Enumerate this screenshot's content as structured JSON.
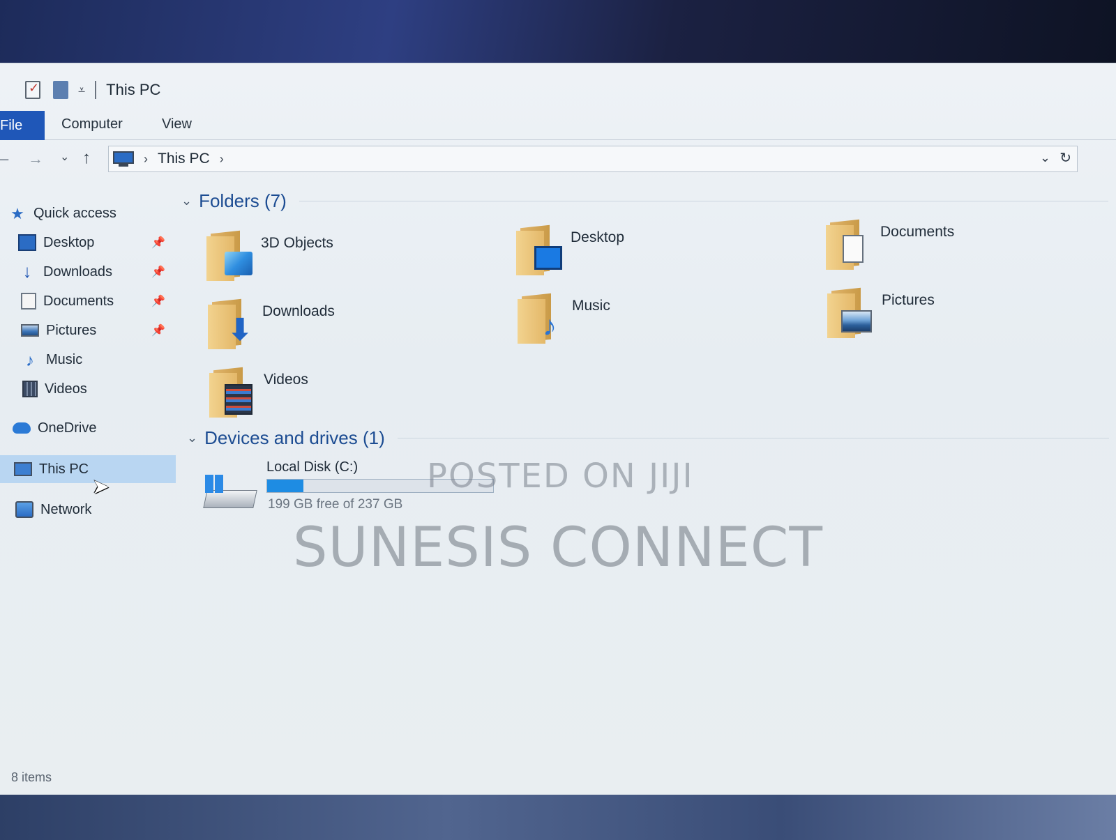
{
  "window": {
    "title": "This PC"
  },
  "ribbon": {
    "tabs": [
      "File",
      "Computer",
      "View"
    ],
    "active_tab": "File"
  },
  "address": {
    "breadcrumb": [
      "This PC"
    ]
  },
  "sidebar": {
    "items": [
      {
        "label": "Quick access",
        "icon": "star-icon"
      },
      {
        "label": "Desktop",
        "icon": "desktop-icon",
        "pinned": true
      },
      {
        "label": "Downloads",
        "icon": "download-arrow-icon",
        "pinned": true
      },
      {
        "label": "Documents",
        "icon": "document-icon",
        "pinned": true
      },
      {
        "label": "Pictures",
        "icon": "picture-icon",
        "pinned": true
      },
      {
        "label": "Music",
        "icon": "music-note-icon"
      },
      {
        "label": "Videos",
        "icon": "film-icon"
      },
      {
        "label": "OneDrive",
        "icon": "cloud-icon"
      },
      {
        "label": "This PC",
        "icon": "computer-icon",
        "selected": true
      },
      {
        "label": "Network",
        "icon": "network-icon"
      }
    ]
  },
  "content": {
    "folders_header": "Folders (7)",
    "folders": [
      {
        "name": "3D Objects",
        "icon": "cube-icon"
      },
      {
        "name": "Desktop",
        "icon": "desktop-icon"
      },
      {
        "name": "Documents",
        "icon": "document-icon"
      },
      {
        "name": "Downloads",
        "icon": "download-arrow-icon"
      },
      {
        "name": "Music",
        "icon": "music-note-icon"
      },
      {
        "name": "Pictures",
        "icon": "picture-icon"
      },
      {
        "name": "Videos",
        "icon": "film-icon"
      }
    ],
    "devices_header": "Devices and drives (1)",
    "drives": [
      {
        "name": "Local Disk (C:)",
        "free_text": "199 GB free of 237 GB",
        "used_fraction": 0.16
      }
    ]
  },
  "watermark": {
    "line1": "POSTED ON JIJI",
    "line2": "SUNESIS CONNECT"
  },
  "status": {
    "items_text": "8 items"
  },
  "colors": {
    "accent": "#1f57b8",
    "selection": "#b9d6f2",
    "header_text": "#1c4c92",
    "drive_bar": "#1e8ce3"
  }
}
